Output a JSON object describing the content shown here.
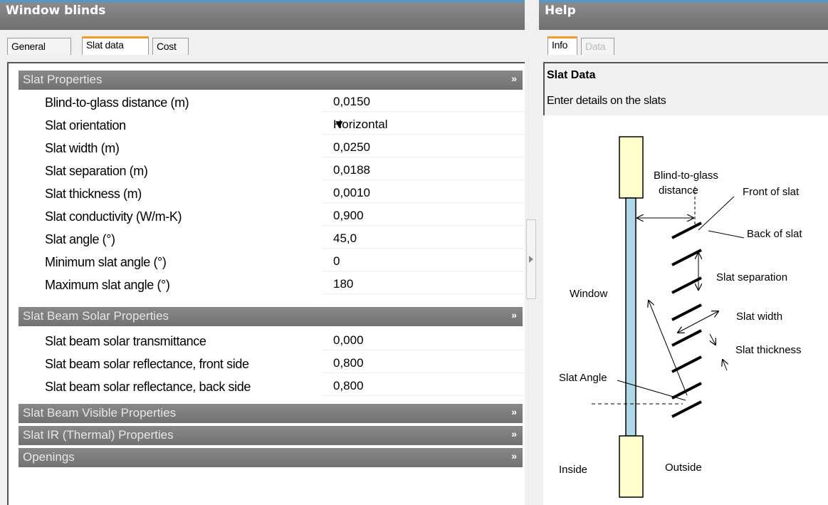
{
  "window": {
    "title": "Window blinds"
  },
  "tabs": [
    {
      "label": "General",
      "active": false
    },
    {
      "label": "Slat data",
      "active": true
    },
    {
      "label": "Cost",
      "active": false
    }
  ],
  "sections": [
    {
      "title": "Slat Properties",
      "expanded": true,
      "rows": [
        {
          "label": "Blind-to-glass distance (m)",
          "value": "0,0150"
        },
        {
          "label": "Slat orientation",
          "value": "Horizontal",
          "dropdown": true
        },
        {
          "label": "Slat width (m)",
          "value": "0,0250"
        },
        {
          "label": "Slat separation (m)",
          "value": "0,0188"
        },
        {
          "label": "Slat thickness (m)",
          "value": "0,0010"
        },
        {
          "label": "Slat conductivity (W/m-K)",
          "value": "0,900"
        },
        {
          "label": "Slat angle (°)",
          "value": "45,0"
        },
        {
          "label": "Minimum slat angle (°)",
          "value": "0"
        },
        {
          "label": "Maximum slat angle (°)",
          "value": "180"
        }
      ]
    },
    {
      "title": "Slat Beam Solar Properties",
      "expanded": true,
      "rows": [
        {
          "label": "Slat beam solar transmittance",
          "value": "0,000"
        },
        {
          "label": "Slat beam solar reflectance, front side",
          "value": "0,800"
        },
        {
          "label": "Slat beam solar reflectance, back side",
          "value": "0,800"
        }
      ]
    },
    {
      "title": "Slat Beam Visible Properties",
      "expanded": false
    },
    {
      "title": "Slat IR (Thermal) Properties",
      "expanded": false
    },
    {
      "title": "Openings",
      "expanded": false
    }
  ],
  "icons": {
    "expanded": "chevron-double-down-icon",
    "collapsed": "chevron-double-right-icon",
    "splitter": "triangle-right-icon"
  },
  "help": {
    "title": "Help",
    "tabs": [
      {
        "label": "Info",
        "active": true
      },
      {
        "label": "Data",
        "active": false,
        "disabled": true
      }
    ],
    "heading": "Slat Data",
    "text": "Enter details on the slats",
    "diagram_labels": {
      "blind_to_glass_1": "Blind-to-glass",
      "blind_to_glass_2": "distance",
      "front_of_slat": "Front of slat",
      "back_of_slat": "Back of slat",
      "slat_separation": "Slat separation",
      "window": "Window",
      "slat_width": "Slat width",
      "slat_thickness": "Slat thickness",
      "slat_angle": "Slat Angle",
      "inside": "Inside",
      "outside": "Outside"
    }
  },
  "colors": {
    "title_bar": "#7d7d7d",
    "title_bar_top": "#5a96bd",
    "section_header": "#7d7d7d",
    "active_tab_accent": "#f39c2a",
    "glass_fill": "#add8e6",
    "frame_fill": "#ffffcc"
  }
}
